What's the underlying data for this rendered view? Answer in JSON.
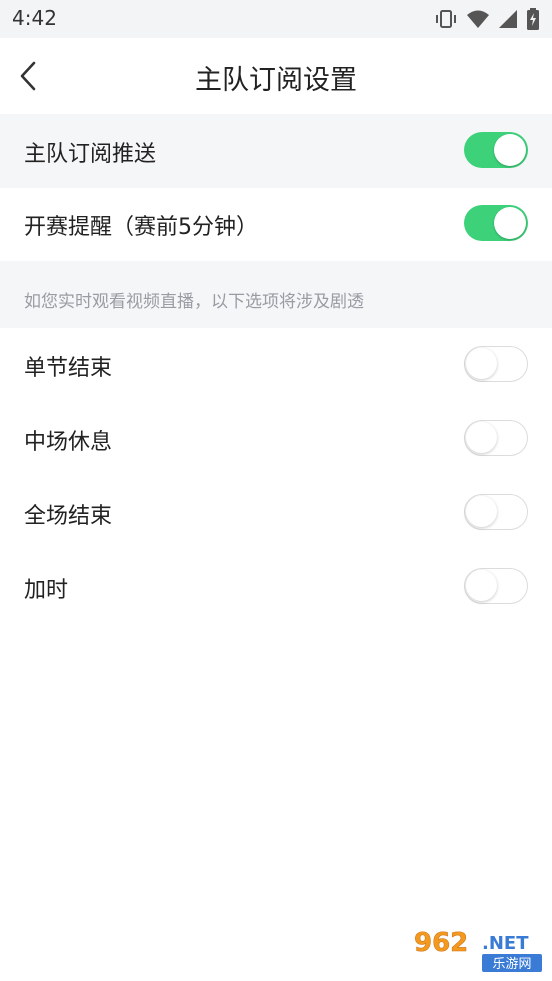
{
  "status_bar": {
    "time": "4:42",
    "icons": [
      "vibrate-icon",
      "wifi-icon",
      "signal-icon",
      "battery-charging-icon"
    ]
  },
  "header": {
    "title": "主队订阅设置",
    "back_icon": "chevron-left-icon"
  },
  "settings": [
    {
      "label": "主队订阅推送",
      "enabled": true
    },
    {
      "label": "开赛提醒（赛前5分钟）",
      "enabled": true
    }
  ],
  "hint": "如您实时观看视频直播，以下选项将涉及剧透",
  "events": [
    {
      "label": "单节结束",
      "enabled": false
    },
    {
      "label": "中场休息",
      "enabled": false
    },
    {
      "label": "全场结束",
      "enabled": false
    },
    {
      "label": "加时",
      "enabled": false
    }
  ],
  "colors": {
    "toggle_on": "#3dd17a",
    "toggle_off_border": "#dcdcdc",
    "band_background": "#f5f6f8",
    "hint_text": "#9a9ca3"
  },
  "watermark": {
    "logo": "962.NET",
    "caption": "乐游网"
  }
}
